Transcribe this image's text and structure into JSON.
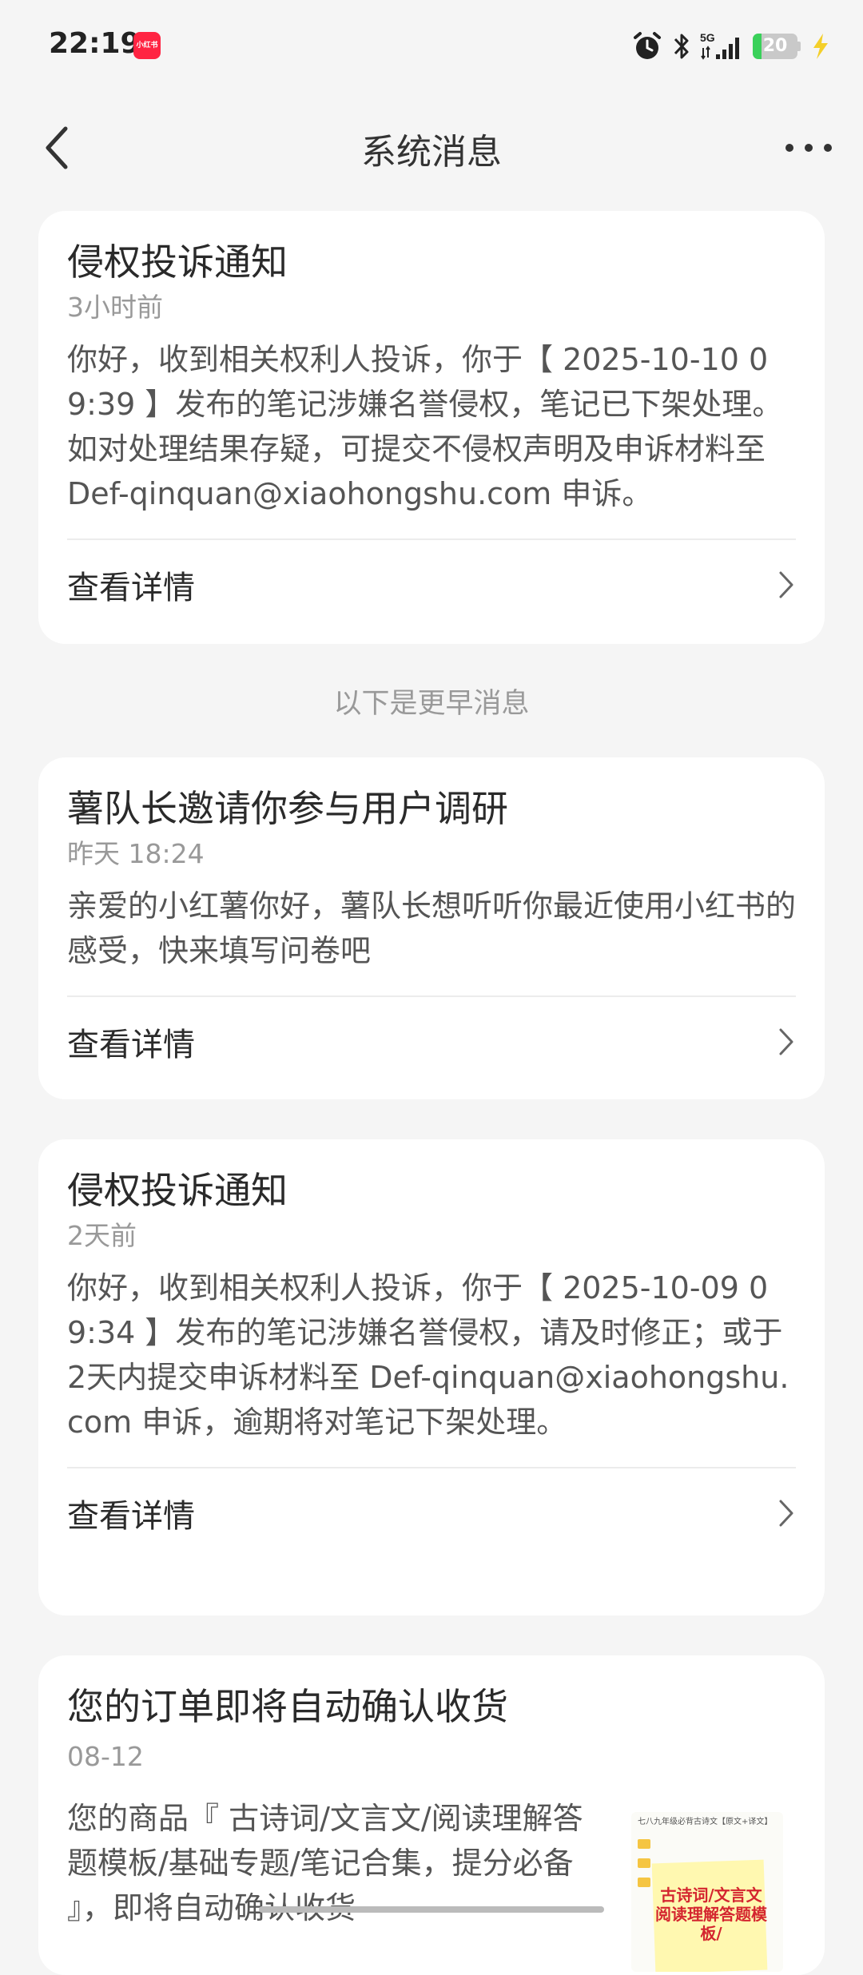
{
  "status_bar": {
    "time": "22:19",
    "app_badge": "小红书",
    "network": "5G",
    "battery_level": "20",
    "battery_fraction": 0.2,
    "icons": [
      "alarm-icon",
      "bluetooth-icon",
      "signal-5g-icon",
      "battery-icon",
      "charging-bolt-icon"
    ]
  },
  "nav": {
    "title": "系统消息",
    "back_icon": "chevron-left-icon",
    "more_icon": "more-dots-icon"
  },
  "earlier_label": "以下是更早消息",
  "messages": [
    {
      "title": "侵权投诉通知",
      "time": "3小时前",
      "body": "你好，收到相关权利人投诉，你于【 2025-10-10 09:39 】发布的笔记涉嫌名誉侵权，笔记已下架处理。如对处理结果存疑，可提交不侵权声明及申诉材料至 Def-qinquan@xiaohongshu.com 申诉。",
      "action": "查看详情"
    },
    {
      "title": "薯队长邀请你参与用户调研",
      "time": "昨天 18:24",
      "body": "亲爱的小红薯你好，薯队长想听听你最近使用小红书的感受，快来填写问卷吧",
      "action": "查看详情"
    },
    {
      "title": "侵权投诉通知",
      "time": "2天前",
      "body": "你好，收到相关权利人投诉，你于【 2025-10-09 09:34 】发布的笔记涉嫌名誉侵权，请及时修正；或于2天内提交申诉材料至 Def-qinquan@xiaohongshu.com 申诉，逾期将对笔记下架处理。",
      "action": "查看详情"
    },
    {
      "title": "您的订单即将自动确认收货",
      "time": "08-12",
      "body": "您的商品『 古诗词/文言文/阅读理解答题模板/基础专题/笔记合集，提分必备 』，即将自动确认收货",
      "thumbnail_header": "七八九年级必背古诗文【原文+译文】",
      "thumbnail_text": "古诗词/文言文阅读理解答题模板/"
    }
  ]
}
